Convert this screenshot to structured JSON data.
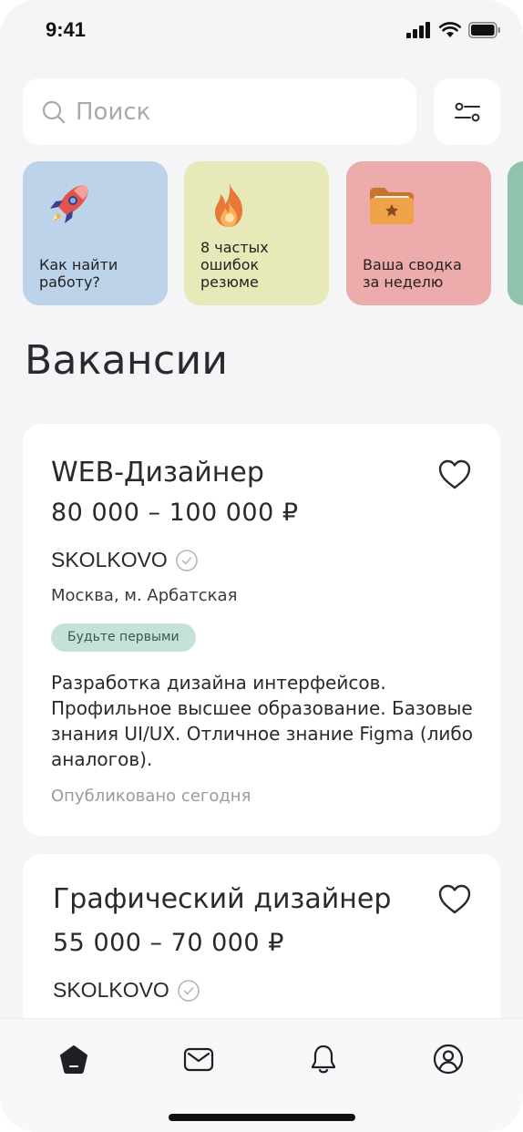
{
  "status_bar": {
    "time": "9:41"
  },
  "search": {
    "placeholder": "Поиск"
  },
  "stories": [
    {
      "label": "Как найти\nработу?",
      "bg": "#bcd3ea",
      "icon": "rocket-icon"
    },
    {
      "label": "8 частых\nошибок\nрезюме",
      "bg": "#e7e9b9",
      "icon": "flame-icon"
    },
    {
      "label": "Ваша сводка\nза неделю",
      "bg": "#eeabab",
      "icon": "folder-star-icon"
    },
    {
      "label": "",
      "bg": "#8fc3ac",
      "icon": ""
    }
  ],
  "section_title": "Вакансии",
  "vacancies": [
    {
      "title": "WEB-Дизайнер",
      "salary": "80 000 – 100 000 ₽",
      "company": "SKOLKOVO",
      "city": "Москва, м. Арбатская",
      "badge": "Будьте первыми",
      "description": "Разработка дизайна интерфейсов. Профильное высшее образование. Базовые знания UI/UX. Отличное знание Figma (либо аналогов).",
      "published": "Опубликовано сегодня"
    },
    {
      "title": "Графический дизайнер",
      "salary": "55 000 – 70 000 ₽",
      "company": "SKOLKOVO"
    }
  ],
  "tabs": [
    "home-icon",
    "mail-icon",
    "bell-icon",
    "profile-icon"
  ],
  "colors": {
    "badge_bg": "#c6e2d6",
    "page_bg": "#f5f5f8"
  }
}
